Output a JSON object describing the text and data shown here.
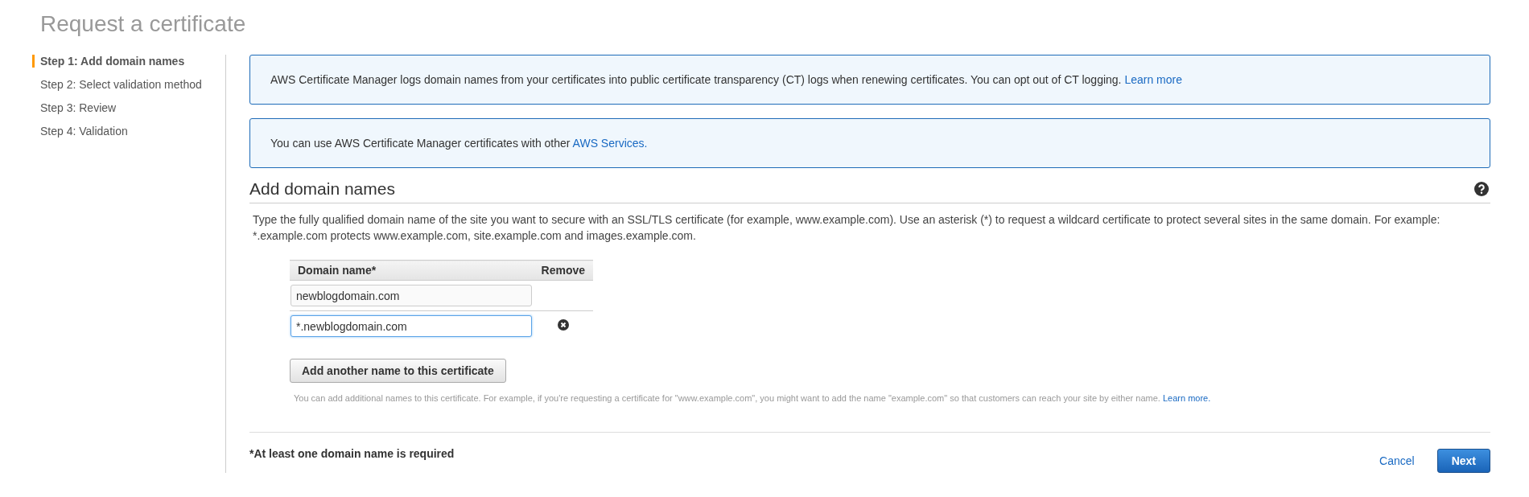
{
  "page_title": "Request a certificate",
  "steps": [
    {
      "label": "Step 1: Add domain names",
      "selected": true
    },
    {
      "label": "Step 2: Select validation method",
      "selected": false
    },
    {
      "label": "Step 3: Review",
      "selected": false
    },
    {
      "label": "Step 4: Validation",
      "selected": false
    }
  ],
  "notices": [
    {
      "text": "AWS Certificate Manager logs domain names from your certificates into public certificate transparency (CT) logs when renewing certificates. You can opt out of CT logging.",
      "link": "Learn more"
    },
    {
      "text": "You can use AWS Certificate Manager certificates with other",
      "link": "AWS Services."
    }
  ],
  "section": {
    "title": "Add domain names",
    "description": "Type the fully qualified domain name of the site you want to secure with an SSL/TLS certificate (for example, www.example.com). Use an asterisk (*) to request a wildcard certificate to protect several sites in the same domain. For example: *.example.com protects www.example.com, site.example.com and images.example.com."
  },
  "table": {
    "columns": [
      "Domain name*",
      "Remove"
    ],
    "rows": [
      {
        "value": "newblogdomain.com",
        "focused": false,
        "removable": false
      },
      {
        "value": "*.newblogdomain.com",
        "focused": true,
        "removable": true
      }
    ]
  },
  "add_button": "Add another name to this certificate",
  "hint": {
    "text": "You can add additional names to this certificate. For example, if you're requesting a certificate for \"www.example.com\", you might want to add the name \"example.com\" so that customers can reach your site by either name.",
    "link": "Learn more."
  },
  "footer": {
    "note": "*At least one domain name is required",
    "cancel": "Cancel",
    "next": "Next"
  }
}
